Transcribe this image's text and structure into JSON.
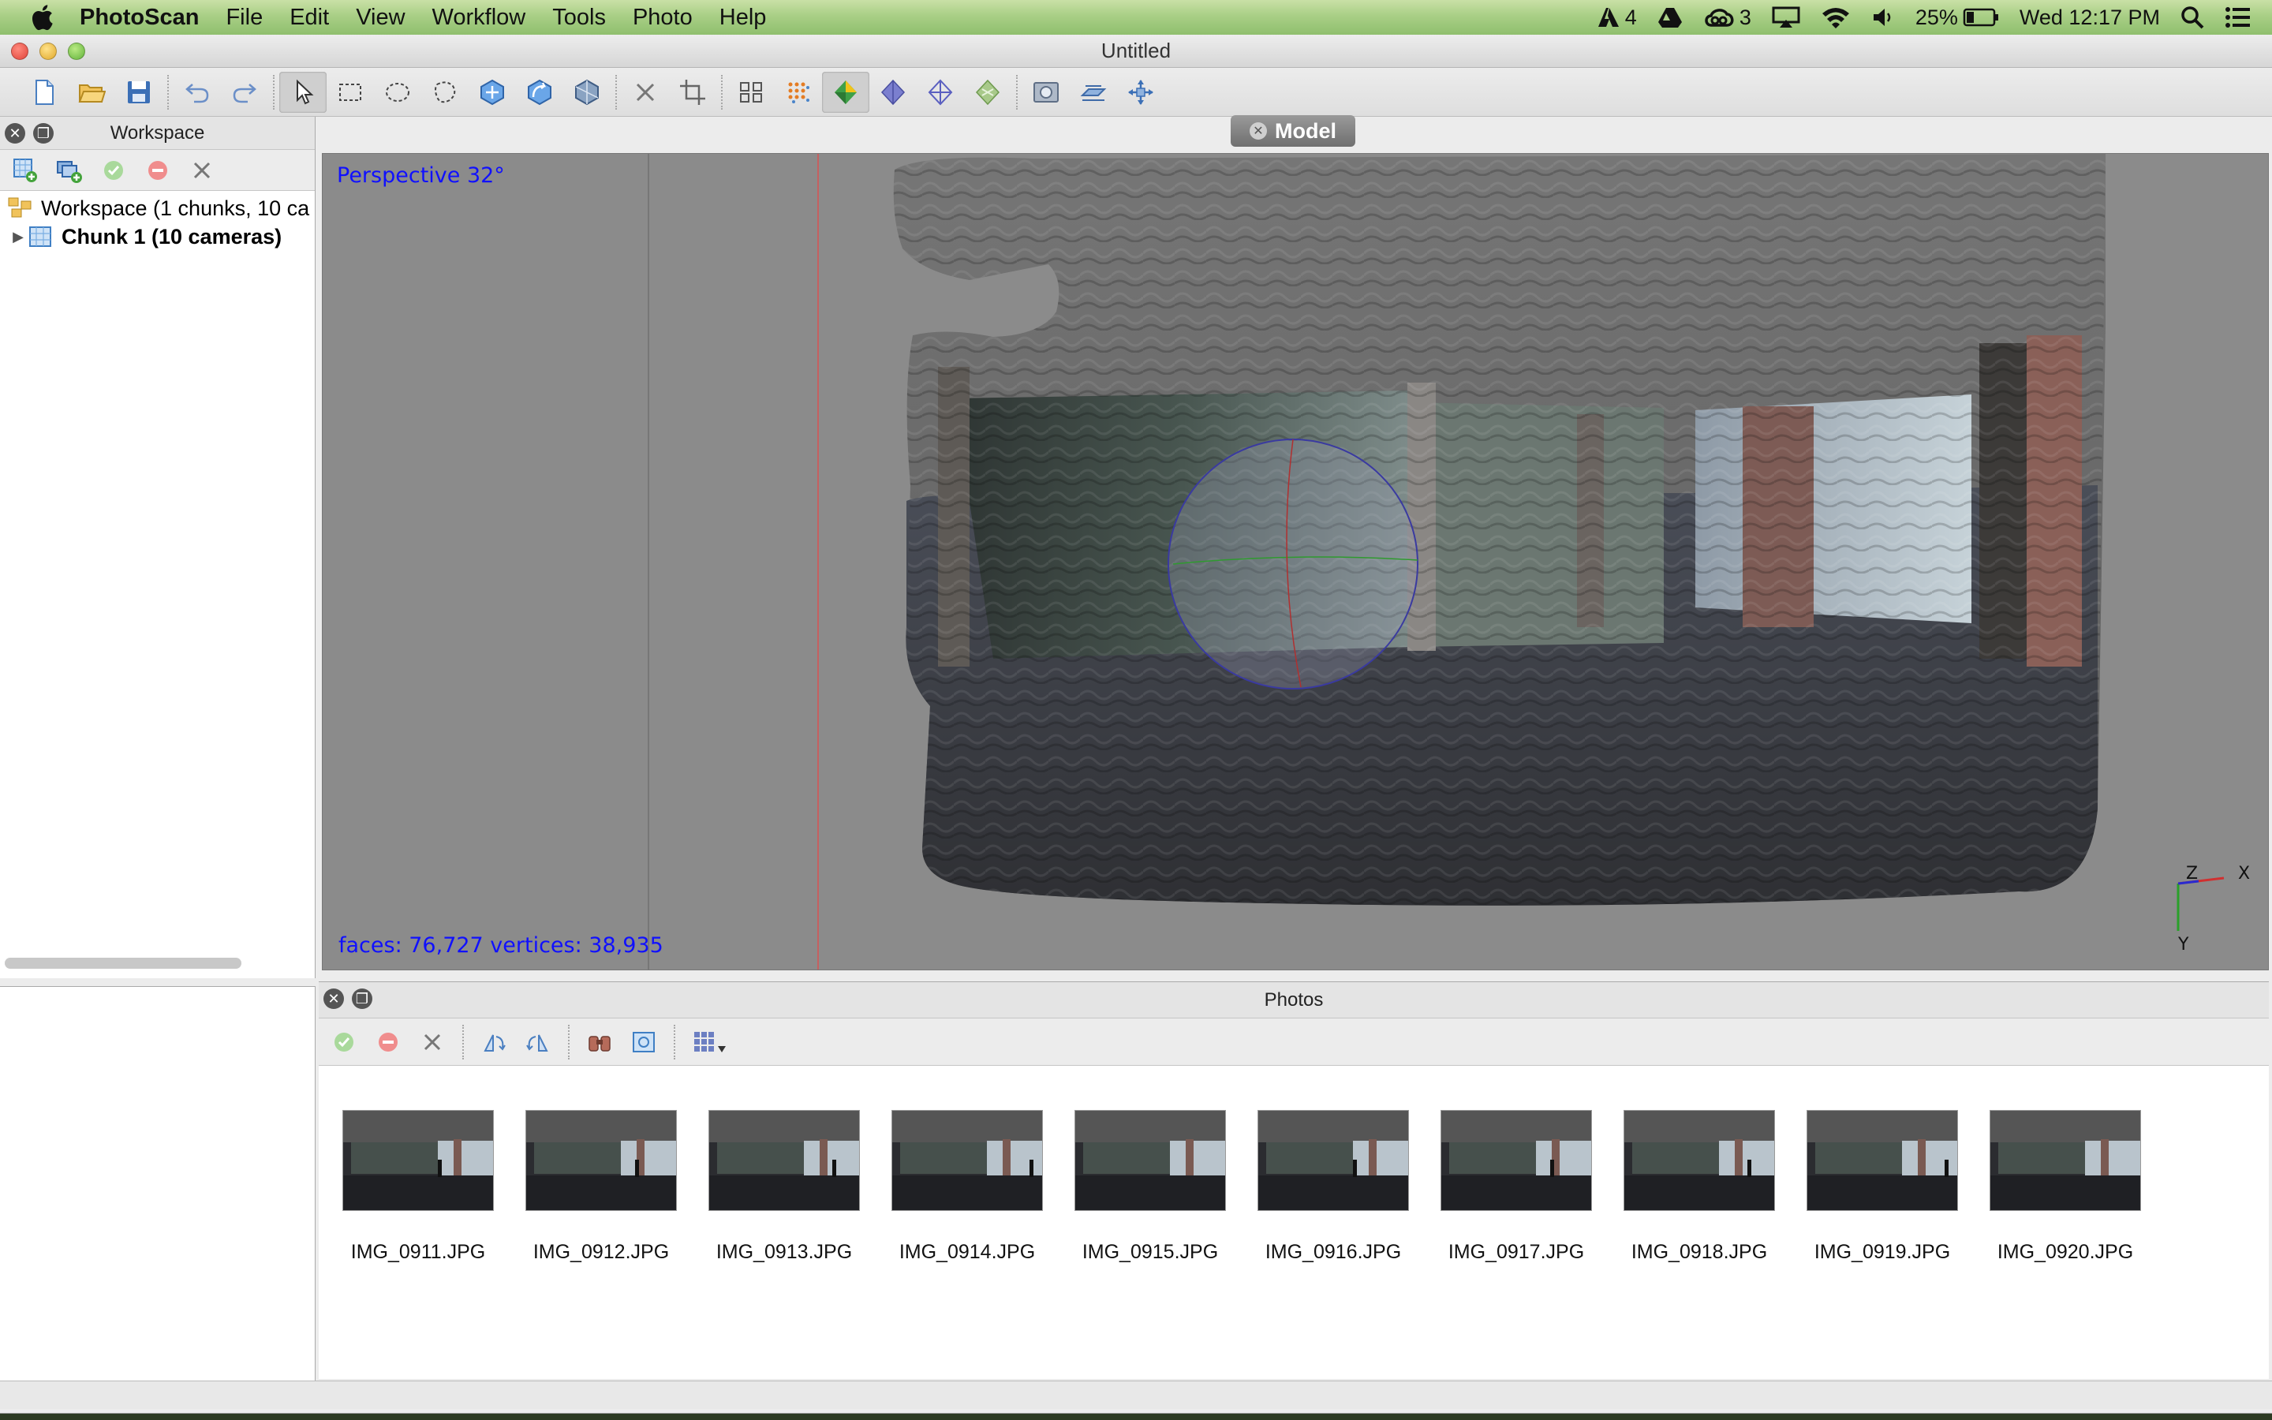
{
  "menubar": {
    "app_name": "PhotoScan",
    "items": [
      "File",
      "Edit",
      "View",
      "Workflow",
      "Tools",
      "Photo",
      "Help"
    ],
    "status": {
      "adobe_count": "4",
      "cc_count": "3",
      "battery": "25%",
      "clock": "Wed 12:17 PM"
    }
  },
  "window": {
    "title": "Untitled"
  },
  "workspace": {
    "title": "Workspace",
    "tree": {
      "root": "Workspace (1 chunks, 10 ca",
      "chunk": "Chunk 1 (10 cameras)"
    }
  },
  "model": {
    "tab_label": "Model",
    "projection": "Perspective 32°",
    "stats": "faces: 76,727 vertices: 38,935",
    "axes": {
      "z": "Z",
      "x": "X",
      "y": "Y"
    }
  },
  "photos": {
    "title": "Photos",
    "items": [
      "IMG_0911.JPG",
      "IMG_0912.JPG",
      "IMG_0913.JPG",
      "IMG_0914.JPG",
      "IMG_0915.JPG",
      "IMG_0916.JPG",
      "IMG_0917.JPG",
      "IMG_0918.JPG",
      "IMG_0919.JPG",
      "IMG_0920.JPG"
    ]
  },
  "colors": {
    "overlay_text": "#1010ff",
    "viewport_bg": "#8b8b8b",
    "accent_green": "#5db34a",
    "accent_red": "#e0443a"
  },
  "icons": {
    "toolbar": [
      "new-doc-icon",
      "open-folder-icon",
      "save-icon",
      "undo-icon",
      "redo-icon",
      "navigation-pointer-icon",
      "rectangle-select-icon",
      "circle-select-icon",
      "free-select-icon",
      "resize-region-icon",
      "rotate-region-icon",
      "rotate-object-icon",
      "delete-selection-icon",
      "crop-icon",
      "show-cameras-icon",
      "point-cloud-icon",
      "shaded-model-icon",
      "solid-model-icon",
      "wireframe-model-icon",
      "textured-model-icon",
      "capture-view-icon",
      "ground-plane-icon",
      "reset-view-icon"
    ]
  }
}
